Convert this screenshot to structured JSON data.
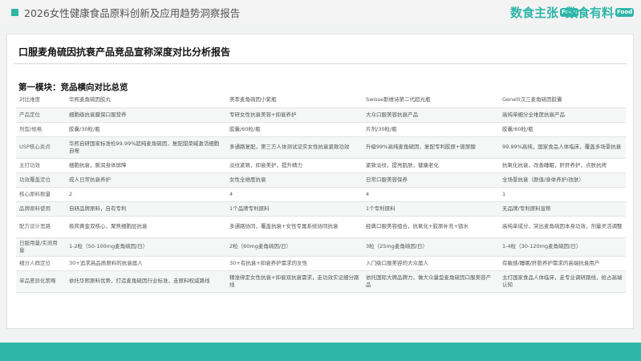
{
  "header": {
    "report_title": "2026女性健康食品原料创新及应用趋势洞察报告",
    "brands": [
      {
        "name": "数食主张",
        "tag": "Food"
      },
      {
        "name": "数食有料",
        "tag": "Food"
      }
    ]
  },
  "card": {
    "title": "口服麦角硫因抗衰产品竞品宣称深度对比分析报告",
    "section_title": "第一模块：竞品横向对比总览"
  },
  "table": {
    "rows": [
      {
        "label": "对比维度",
        "cells": [
          "华熙麦角硫因胶丸",
          "美萃麦角硫因小紫瓶",
          "Swisse斯维诗第二代超光瓶",
          "Genelli汉三麦角硫因胶囊"
        ]
      },
      {
        "label": "产品定位",
        "cells": [
          "细胞级抗衰膜保口服营养",
          "专研女性抗衰美容+抑衰养护",
          "大众口服美容抗衰产品",
          "高纯单细分全维度抗衰产品"
        ]
      },
      {
        "label": "剂型/规格",
        "cells": [
          "胶囊/30粒/瓶",
          "胶囊/60粒/瓶",
          "片剂/30粒/瓶",
          "胶囊/60粒/瓶"
        ]
      },
      {
        "label": "USP核心卖点",
        "cells": [
          "华熙自研国家标准检99.99%超纯麦角硫因，复配甜菜碱激活细胞自噬",
          "多通路复配，第三方人体测试证实女性抗衰紧致功效",
          "升级99%高纯麦角硫因，复配专利胶原+玻尿酸",
          "99.99%高纯，国家食品人体临床，覆盖多场景抗衰"
        ]
      },
      {
        "label": "主打功效",
        "cells": [
          "细胞抗衰，膨润身体屏障",
          "淡纹紧致，抑衰美护，提升精力",
          "紧致淡纹，提亮肌肤，健康老化",
          "抗氧化抗衰，改善睡眠，肝肝养护，点肤抗烤"
        ]
      },
      {
        "label": "功效覆盖定位",
        "cells": [
          "成人日常抗衰养护",
          "女性全维度抗衰",
          "日常口服美容保养",
          "全场景抗衰（颜值/身体养护/改肤）"
        ]
      },
      {
        "label": "核心原料数量",
        "cells": [
          "2",
          "4",
          "4",
          "1"
        ]
      },
      {
        "label": "品牌原料使用",
        "cells": [
          "自研品牌原料，自有专利",
          "1个品牌专利原料",
          "1个专利原料",
          "无品牌/专利原料宣称"
        ]
      },
      {
        "label": "配方设计思路",
        "cells": [
          "极简黄金双核心，聚焦细胞层抗衰",
          "多通路协同，覆盖抗衰+女性专属系统协同抗衰",
          "经典口服美容组合，抗氧化+胶原补充+锁水",
          "高纯单成分，突出麦角硫因本身功效，剂量灵活调整"
        ]
      },
      {
        "label": "日服用量/实测用量",
        "cells": [
          "1-2粒（50-100mg麦角硫因/日）",
          "2粒（60mg麦角硫因/日）",
          "3粒（25mg麦角硫因/日）",
          "1-4粒（30-120mg麦角硫因/日）"
        ]
      },
      {
        "label": "细分人群定位",
        "cells": [
          "30+追求高品质原料的抗衰届人",
          "30+有抗衰+抑衰养护需求的女性",
          "入门级口服美容的大众届人",
          "有敏感/睡眠/肝脏养护需求的高端抗衰用户"
        ]
      },
      {
        "label": "单品差异化策略",
        "cells": [
          "依托华熙原料优势，打造麦角硫因行业标准，走原料权威路线",
          "精准绑定女性抗衰+抑衰双抗衰需求，走功效实证细分路线",
          "依托国际大牌品牌力，做大众量型麦角硫因口服美容产品",
          "主打国家食品人体临床，走专业调研路线，抢占高端认知"
        ]
      }
    ]
  }
}
